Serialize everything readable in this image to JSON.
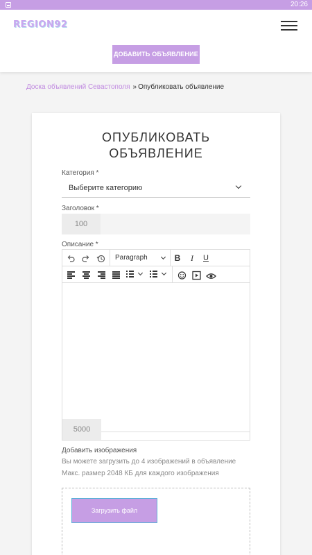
{
  "statusbar": {
    "time": "20:26",
    "icon": "image-notification-icon"
  },
  "header": {
    "logo": "REGION92",
    "menu_icon": "hamburger-menu-icon",
    "add_button": "ДОБАВИТЬ ОБЪЯВЛЕНИЕ"
  },
  "breadcrumb": {
    "home": "Доска объявлений Севастополя",
    "separator": "»",
    "current": "Опубликовать объявление"
  },
  "form": {
    "title_line1": "ОПУБЛИКОВАТЬ",
    "title_line2": "ОБЪЯВЛЕНИЕ",
    "category_label": "Категория *",
    "category_value": "Выберите категорию",
    "heading_label": "Заголовок *",
    "heading_counter": "100",
    "description_label": "Описание *",
    "description_counter": "5000",
    "editor": {
      "paragraph_format": "Paragraph",
      "tools": [
        "undo-icon",
        "redo-icon",
        "history-icon",
        "bold-icon",
        "italic-icon",
        "underline-icon",
        "align-left-icon",
        "align-center-icon",
        "align-right-icon",
        "align-justify-icon",
        "bullet-list-icon",
        "numbered-list-icon",
        "emoji-icon",
        "video-icon",
        "preview-icon"
      ]
    },
    "images_label": "Добавить изображения",
    "images_hint1": "Вы можете загрузить до 4 изображений в объявление",
    "images_hint2": "Макс. размер 2048 КБ для каждого изображения",
    "upload_button": "Загрузить файл"
  },
  "colors": {
    "accent": "#c69ee4",
    "link": "#c08ae0",
    "logo": "#c9a6ef"
  }
}
